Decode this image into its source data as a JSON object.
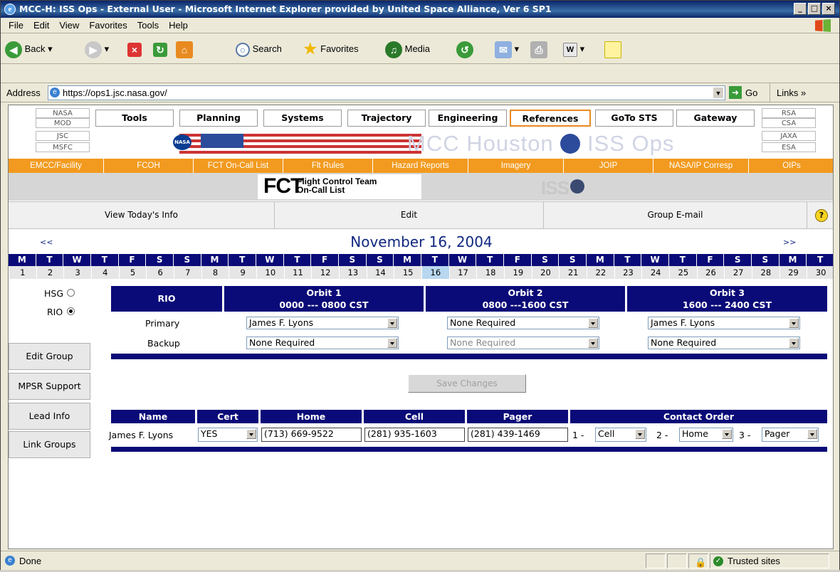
{
  "window": {
    "title": "MCC-H: ISS Ops - External User - Microsoft Internet Explorer provided by United Space Alliance, Ver 6 SP1"
  },
  "menu": [
    "File",
    "Edit",
    "View",
    "Favorites",
    "Tools",
    "Help"
  ],
  "toolbar": {
    "back": "Back",
    "search": "Search",
    "favorites": "Favorites",
    "media": "Media"
  },
  "address": {
    "label": "Address",
    "url": "https://ops1.jsc.nasa.gov/",
    "go": "Go",
    "links": "Links"
  },
  "site": {
    "left_centers": [
      "NASA",
      "MOD",
      "JSC",
      "MSFC"
    ],
    "right_centers": [
      "RSA",
      "CSA",
      "JAXA",
      "ESA"
    ],
    "nav": [
      "Tools",
      "Planning",
      "Systems",
      "Trajectory",
      "Engineering",
      "References",
      "GoTo STS",
      "Gateway"
    ],
    "nav_active": "References",
    "banner": "MCC Houston",
    "banner2": "ISS Ops",
    "subnav": [
      "EMCC/Facility",
      "FCOH",
      "FCT On-Call List",
      "Flt Rules",
      "Hazard Reports",
      "Imagery",
      "JOIP",
      "NASA/IP Corresp",
      "OIPs"
    ]
  },
  "fct": {
    "logo": "FCT",
    "line1": "Flight Control Team",
    "line2": "On-Call List",
    "iss": "ISS"
  },
  "actions": {
    "today": "View Today's Info",
    "edit": "Edit",
    "email": "Group E-mail",
    "help": "?"
  },
  "date": {
    "title": "November 16, 2004",
    "prev": "<<",
    "next": ">>"
  },
  "calendar": {
    "weekdays": [
      "M",
      "T",
      "W",
      "T",
      "F",
      "S",
      "S",
      "M",
      "T",
      "W",
      "T",
      "F",
      "S",
      "S",
      "M",
      "T",
      "W",
      "T",
      "F",
      "S",
      "S",
      "M",
      "T",
      "W",
      "T",
      "F",
      "S",
      "S",
      "M",
      "T"
    ],
    "days": [
      "1",
      "2",
      "3",
      "4",
      "5",
      "6",
      "7",
      "8",
      "9",
      "10",
      "11",
      "12",
      "13",
      "14",
      "15",
      "16",
      "17",
      "18",
      "19",
      "20",
      "21",
      "22",
      "23",
      "24",
      "25",
      "26",
      "27",
      "28",
      "29",
      "30"
    ],
    "selected_day": "16"
  },
  "groups": {
    "hsg": "HSG",
    "rio": "RIO",
    "selected": "RIO"
  },
  "side_buttons": [
    "Edit Group",
    "MPSR Support",
    "Lead Info",
    "Link Groups"
  ],
  "schedule": {
    "group": "RIO",
    "orbits": [
      {
        "name": "Orbit 1",
        "time": "0000 --- 0800 CST"
      },
      {
        "name": "Orbit 2",
        "time": "0800 ---1600 CST"
      },
      {
        "name": "Orbit 3",
        "time": "1600 --- 2400 CST"
      }
    ],
    "rows": [
      {
        "label": "Primary",
        "values": [
          "James F. Lyons",
          "None Required",
          "James F. Lyons"
        ]
      },
      {
        "label": "Backup",
        "values": [
          "None Required",
          "None Required",
          "None Required"
        ]
      }
    ],
    "save": "Save Changes"
  },
  "contacts": {
    "headers": [
      "Name",
      "Cert",
      "Home",
      "Cell",
      "Pager",
      "Contact Order"
    ],
    "row": {
      "name": "James F. Lyons",
      "cert": "YES",
      "home": "(713) 669-9522",
      "cell": "(281) 935-1603",
      "pager": "(281) 439-1469",
      "order": [
        {
          "n": "1 -",
          "v": "Cell"
        },
        {
          "n": "2 -",
          "v": "Home"
        },
        {
          "n": "3 -",
          "v": "Pager"
        }
      ]
    }
  },
  "status": {
    "left": "Done",
    "zone": "Trusted sites"
  },
  "colors": {
    "navy": "#0a0a78",
    "orange": "#f29a1f",
    "titlebar": "#0a246a"
  }
}
